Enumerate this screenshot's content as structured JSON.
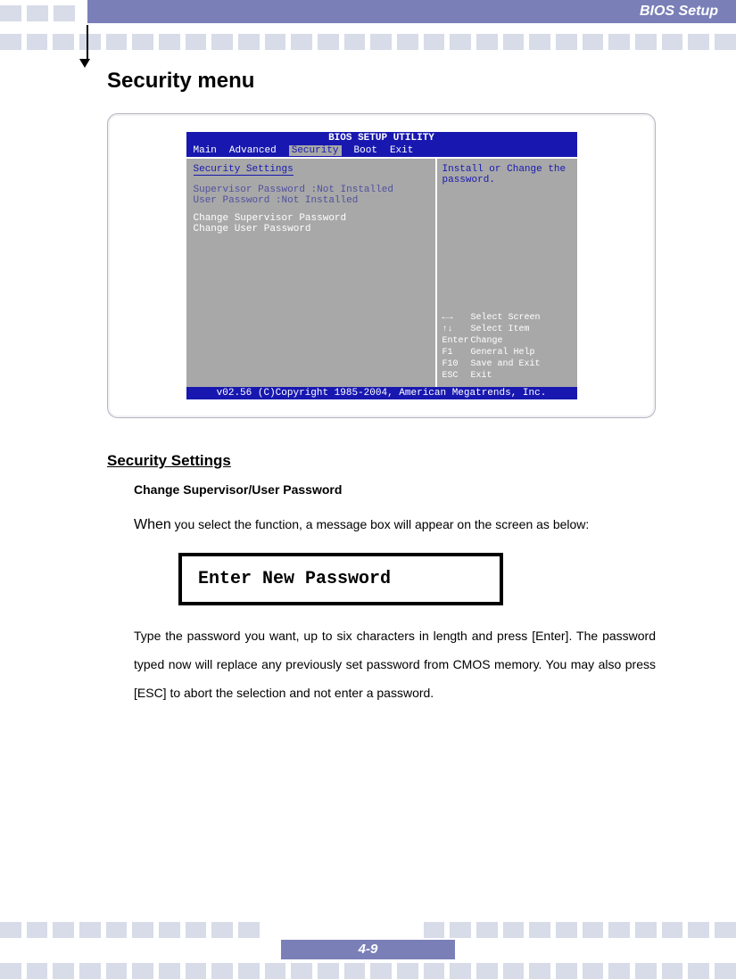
{
  "header": {
    "title": "BIOS Setup"
  },
  "section": {
    "title": "Security menu"
  },
  "bios": {
    "utility_title": "BIOS SETUP UTILITY",
    "menu": {
      "main": "Main",
      "advanced": "Advanced",
      "security": "Security",
      "boot": "Boot",
      "exit": "Exit"
    },
    "left": {
      "settings_title": "Security Settings",
      "sup_row": "Supervisor Password :Not Installed",
      "user_row": "User Password      :Not Installed",
      "change_sup": "Change Supervisor Password",
      "change_user": "Change User Password"
    },
    "right": {
      "help": "Install or Change the password.",
      "nav1_key": "←→",
      "nav1_txt": "Select Screen",
      "nav2_key": "↑↓",
      "nav2_txt": "Select Item",
      "nav3_key": "Enter",
      "nav3_txt": "Change",
      "nav4_key": "F1",
      "nav4_txt": "General Help",
      "nav5_key": "F10",
      "nav5_txt": "Save and Exit",
      "nav6_key": "ESC",
      "nav6_txt": "Exit"
    },
    "footer": "v02.56 (C)Copyright 1985-2004, American Megatrends, Inc."
  },
  "body": {
    "subhead": "Security Settings",
    "bold_line": "Change Supervisor/User Password",
    "p1a": "When",
    "p1b": " you select the function, a message box will appear on the screen as below:",
    "msg": "Enter New Password",
    "p2": "Type the password you want, up to six characters in length and press [Enter].  The password typed now will replace any previously set password from CMOS memory. You may also press [ESC] to abort the selection and not enter a password."
  },
  "footer": {
    "page": "4-9"
  }
}
